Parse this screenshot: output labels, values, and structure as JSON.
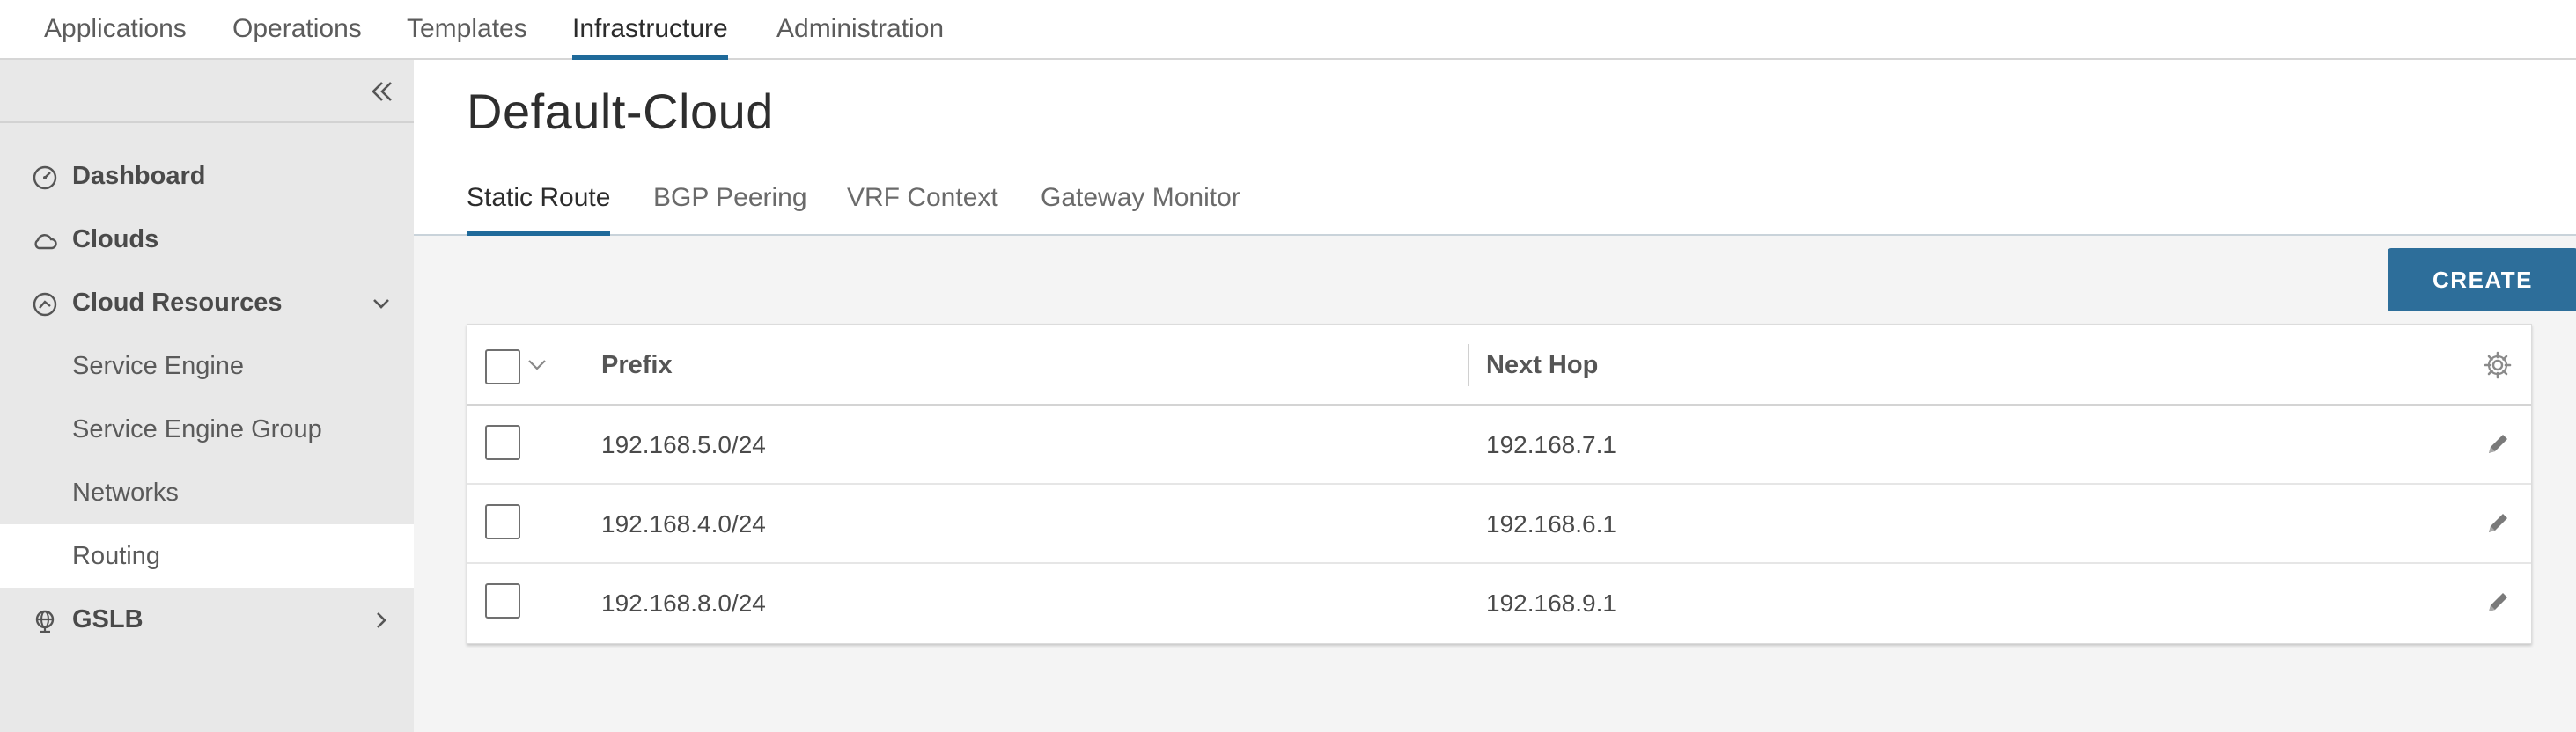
{
  "top_nav": {
    "tabs": [
      {
        "label": "Applications",
        "active": false
      },
      {
        "label": "Operations",
        "active": false
      },
      {
        "label": "Templates",
        "active": false
      },
      {
        "label": "Infrastructure",
        "active": true
      },
      {
        "label": "Administration",
        "active": false
      }
    ]
  },
  "sidebar": {
    "collapse_icon": "double-chevron-left-icon",
    "items": [
      {
        "label": "Dashboard",
        "icon": "dashboard-icon"
      },
      {
        "label": "Clouds",
        "icon": "cloud-icon"
      },
      {
        "label": "Cloud Resources",
        "icon": "cloud-resources-icon",
        "expanded": true
      },
      {
        "label": "Service Engine"
      },
      {
        "label": "Service Engine Group"
      },
      {
        "label": "Networks"
      },
      {
        "label": "Routing",
        "selected": true
      },
      {
        "label": "GSLB",
        "icon": "gslb-icon",
        "expanded": false
      }
    ]
  },
  "main": {
    "title": "Default-Cloud",
    "tabs": [
      {
        "label": "Static Route",
        "active": true
      },
      {
        "label": "BGP Peering",
        "active": false
      },
      {
        "label": "VRF Context",
        "active": false
      },
      {
        "label": "Gateway Monitor",
        "active": false
      }
    ],
    "create_label": "CREATE"
  },
  "table": {
    "columns": [
      "Prefix",
      "Next Hop"
    ],
    "rows": [
      {
        "prefix": "192.168.5.0/24",
        "next_hop": "192.168.7.1"
      },
      {
        "prefix": "192.168.4.0/24",
        "next_hop": "192.168.6.1"
      },
      {
        "prefix": "192.168.8.0/24",
        "next_hop": "192.168.9.1"
      }
    ]
  },
  "colors": {
    "accent": "#1f6a9a",
    "create_button": "#2d6e9a",
    "sidebar_bg": "#e8e8e8"
  }
}
